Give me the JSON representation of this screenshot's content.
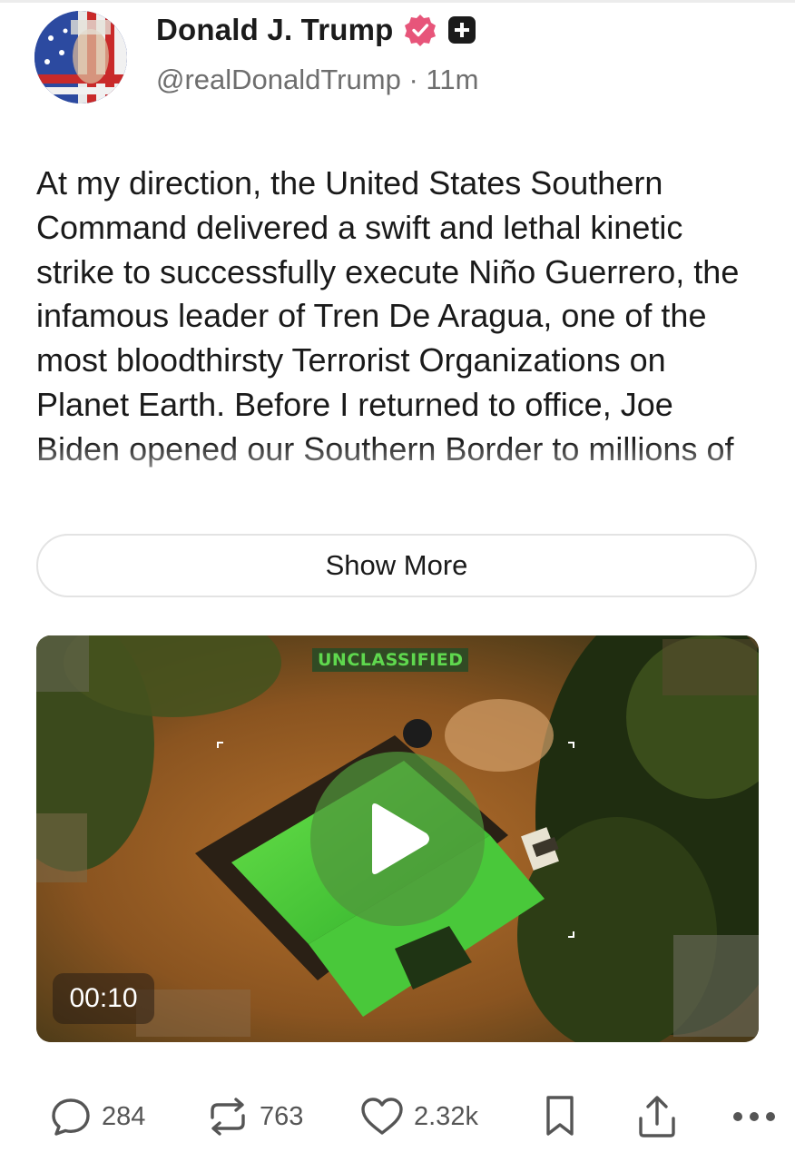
{
  "post": {
    "display_name": "Donald J. Trump",
    "handle": "@realDonaldTrump",
    "separator": "·",
    "time_ago": "11m",
    "text": "At my direction, the United States Southern Command delivered a swift and lethal kinetic strike to successfully execute Niño Guerrero, the infamous leader of Tren De Aragua, one of the most bloodthirsty Terrorist Organizations on Planet Earth. Before I returned to office, Joe Biden opened our Southern Border to millions of",
    "show_more_label": "Show More"
  },
  "media": {
    "overlay_label": "UNCLASSIFIED",
    "duration": "00:10",
    "play_icon": "play-icon"
  },
  "actions": {
    "replies": "284",
    "reposts": "763",
    "likes": "2.32k",
    "icons": [
      "reply-icon",
      "repost-icon",
      "like-icon",
      "bookmark-icon",
      "share-icon",
      "more-icon"
    ]
  },
  "colors": {
    "verified_badge": "#e7557a",
    "overlay_green": "#5fd84e",
    "text_primary": "#1a1a1a",
    "text_secondary": "#6e6e6e"
  }
}
